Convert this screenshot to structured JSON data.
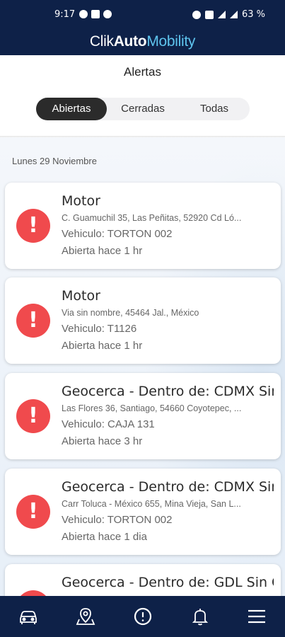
{
  "status_bar": {
    "time": "9:17",
    "battery": "63 %"
  },
  "brand": {
    "part1": "Clik",
    "part2": "Auto",
    "part3": "Mobility"
  },
  "page": {
    "title": "Alertas"
  },
  "tabs": [
    {
      "label": "Abiertas",
      "active": true
    },
    {
      "label": "Cerradas",
      "active": false
    },
    {
      "label": "Todas",
      "active": false
    }
  ],
  "date_group": "Lunes 29 Noviembre",
  "alerts": [
    {
      "title": "Motor",
      "address": "C. Guamuchil 35, Las Peñitas, 52920 Cd Ló...",
      "vehicle": "Vehiculo: TORTON 002",
      "age": "Abierta hace 1 hr"
    },
    {
      "title": "Motor",
      "address": "Via sin nombre, 45464 Jal., México",
      "vehicle": "Vehiculo: T1126",
      "age": "Abierta hace 1 hr"
    },
    {
      "title": "Geocerca - Dentro de: CDMX Sin",
      "address": "Las Flores 36, Santiago, 54660 Coyotepec, ...",
      "vehicle": "Vehiculo: CAJA 131",
      "age": "Abierta hace 3 hr"
    },
    {
      "title": "Geocerca - Dentro de: CDMX Sin",
      "address": "Carr Toluca - México 655, Mina Vieja, San L...",
      "vehicle": "Vehiculo: TORTON 002",
      "age": "Abierta hace 1 dia"
    },
    {
      "title": "Geocerca - Dentro de: GDL Sin C",
      "address": "",
      "vehicle": "",
      "age": ""
    }
  ],
  "alert_icon_glyph": "!",
  "colors": {
    "navy": "#0e2148",
    "accent_blue": "#5ec4ee",
    "alert_red": "#f04a4d"
  },
  "bottom_nav": [
    {
      "icon": "car-icon"
    },
    {
      "icon": "map-pin-icon"
    },
    {
      "icon": "alert-circle-icon"
    },
    {
      "icon": "bell-icon"
    },
    {
      "icon": "menu-icon"
    }
  ]
}
